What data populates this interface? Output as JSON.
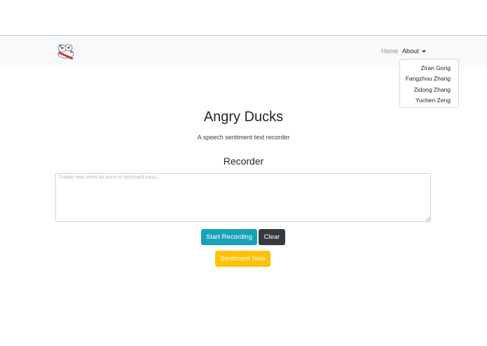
{
  "navbar": {
    "logo_icon": "angry-duck-logo-icon",
    "home_label": "Home",
    "about_label": "About",
    "about_menu": [
      "Ziran Gong",
      "Fangzhou Zhang",
      "Zidong Zhang",
      "Yuchen Zeng"
    ]
  },
  "main": {
    "title": "Angry Ducks",
    "subtitle": "A speech sentiment text recorder",
    "section_title": "Recorder",
    "notes_placeholder": "Create new notes by voice or keyboard input...",
    "notes_value": ""
  },
  "buttons": {
    "start_recording": "Start Recording",
    "clear": "Clear",
    "sentiment_now": "Sentiment Now"
  },
  "colors": {
    "navbar_bg": "#f8f9fa",
    "start_button": "#17a2b8",
    "clear_button": "#343a40",
    "sentiment_button": "#ffc107"
  }
}
